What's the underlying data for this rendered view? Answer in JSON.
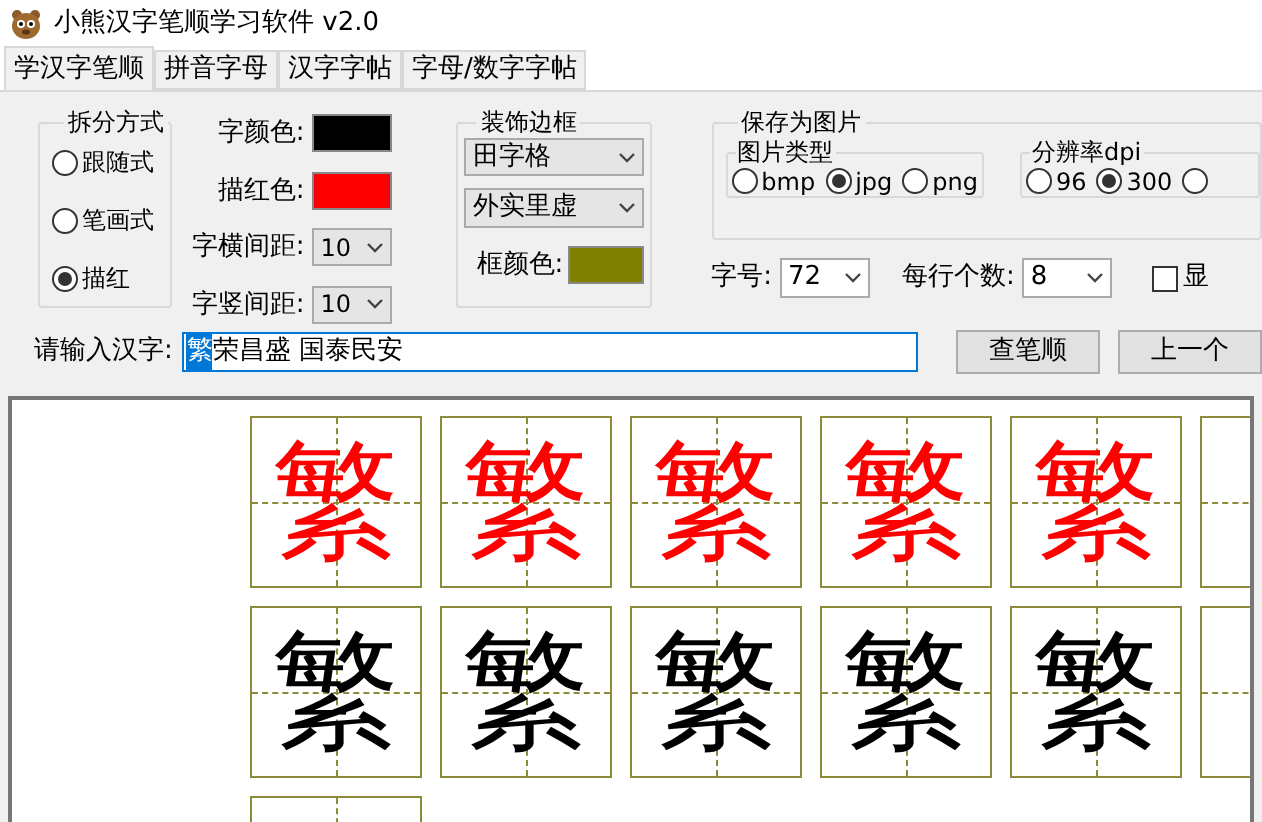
{
  "window": {
    "title": "小熊汉字笔顺学习软件 v2.0"
  },
  "tabs": [
    {
      "label": "学汉字笔顺",
      "selected": true
    },
    {
      "label": "拼音字母",
      "selected": false
    },
    {
      "label": "汉字字帖",
      "selected": false
    },
    {
      "label": "字母/数字字帖",
      "selected": false
    }
  ],
  "split_mode": {
    "title": "拆分方式",
    "options": [
      {
        "label": "跟随式",
        "selected": false
      },
      {
        "label": "笔画式",
        "selected": false
      },
      {
        "label": "描红",
        "selected": true
      }
    ]
  },
  "colors": [
    {
      "label": "字颜色:",
      "color": "#000000"
    },
    {
      "label": "描红色:",
      "color": "#ff0000"
    }
  ],
  "spacing": [
    {
      "label": "字横间距:",
      "value": "10"
    },
    {
      "label": "字竖间距:",
      "value": "10"
    }
  ],
  "border": {
    "title": "装饰边框",
    "style": "田字格",
    "line": "外实里虚",
    "color_label": "框颜色:",
    "color": "#808000"
  },
  "save": {
    "title": "保存为图片",
    "file_type": {
      "title": "图片类型",
      "options": [
        {
          "label": "bmp",
          "selected": false
        },
        {
          "label": "jpg",
          "selected": true
        },
        {
          "label": "png",
          "selected": false
        }
      ]
    },
    "dpi": {
      "title": "分辨率dpi",
      "options": [
        {
          "label": "96",
          "selected": false
        },
        {
          "label": "300",
          "selected": true
        },
        {
          "selected": false
        }
      ]
    }
  },
  "font_size": {
    "label": "字号:",
    "value": "72"
  },
  "per_row": {
    "label": "每行个数:",
    "value": "8"
  },
  "show_checkbox": {
    "label": "显",
    "checked": false
  },
  "input": {
    "label": "请输入汉字:",
    "selected_part": "繁",
    "value": "荣昌盛 国泰民安"
  },
  "buttons": [
    "查笔顺",
    "上一个"
  ],
  "practice": {
    "rows": [
      {
        "cells": [
          {
            "kind": "full",
            "char": "繁"
          },
          {
            "kind": "full",
            "char": "繁"
          },
          {
            "kind": "full",
            "char": "繁"
          },
          {
            "kind": "full",
            "char": "繁"
          },
          {
            "kind": "full",
            "char": "繁"
          },
          {
            "kind": "cut"
          }
        ]
      },
      {
        "cells": [
          {
            "kind": "full",
            "char": "繁"
          },
          {
            "kind": "full",
            "char": "繁"
          },
          {
            "kind": "full",
            "char": "繁"
          },
          {
            "kind": "full",
            "char": "繁"
          },
          {
            "kind": "full",
            "char": "繁"
          },
          {
            "kind": "cut"
          }
        ]
      },
      {
        "cells": [
          {
            "kind": "cut"
          }
        ]
      }
    ]
  }
}
